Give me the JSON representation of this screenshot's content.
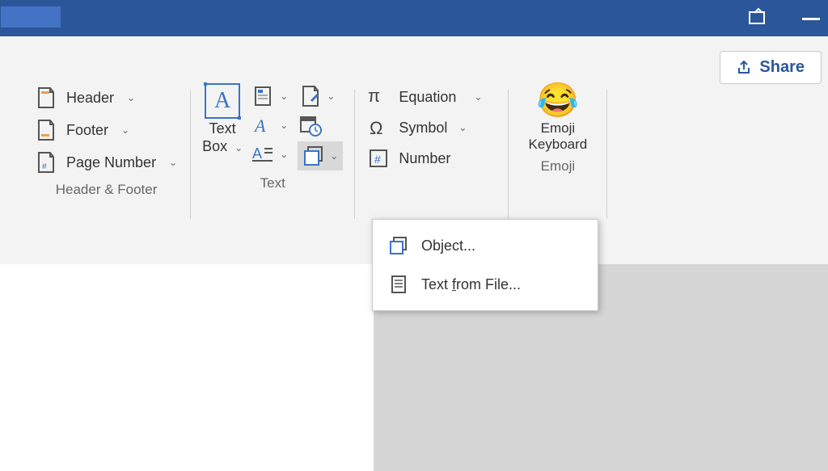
{
  "share": {
    "label": "Share"
  },
  "groups": {
    "header_footer": {
      "label": "Header & Footer",
      "items": {
        "header": "Header",
        "footer": "Footer",
        "page_number": "Page Number"
      }
    },
    "text": {
      "label": "Text",
      "textbox_line1": "Text",
      "textbox_line2": "Box"
    },
    "symbols": {
      "equation": "Equation",
      "symbol": "Symbol",
      "number": "Number"
    },
    "emoji": {
      "label": "Emoji",
      "button_line1": "Emoji",
      "button_line2": "Keyboard"
    }
  },
  "dropdown": {
    "object_pre": "Ob",
    "object_u": "j",
    "object_post": "ect...",
    "text_pre": "Text ",
    "text_u": "f",
    "text_post": "rom File..."
  }
}
